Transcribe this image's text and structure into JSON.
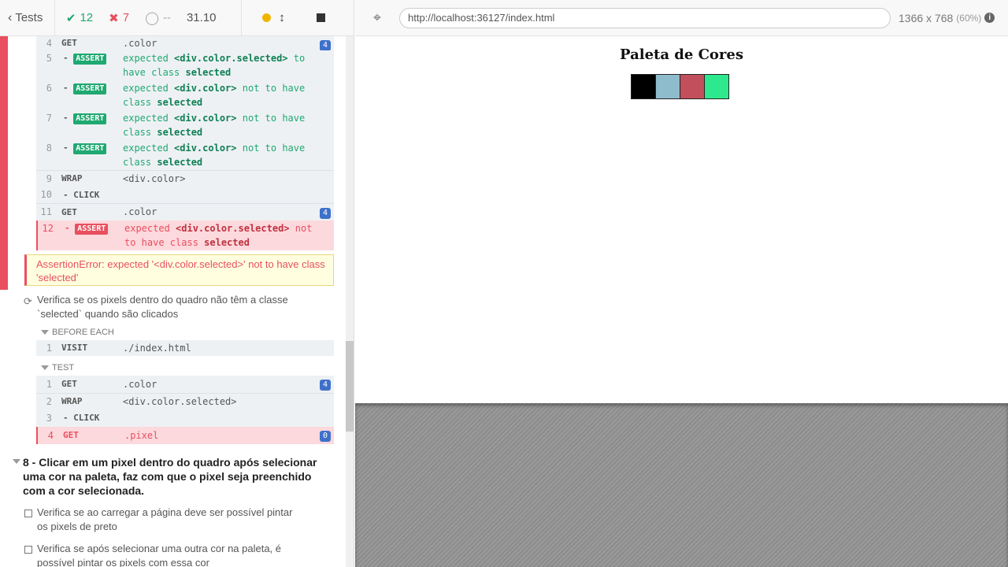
{
  "reporter_header": {
    "tests_label": "Tests",
    "passed": "12",
    "failed": "7",
    "pending": "--",
    "duration": "31.10"
  },
  "aut_header": {
    "url": "http://localhost:36127/index.html",
    "viewport": "1366 x 768",
    "scale": "(60%)"
  },
  "commands_top": [
    {
      "num": "4",
      "name": "GET",
      "msg": ".color",
      "badge": "4"
    },
    {
      "num": "5",
      "name": "-",
      "tag": "ASSERT",
      "pre": "expected",
      "el": "<div.color.selected>",
      "mid": " to have class",
      "cls": "selected"
    },
    {
      "num": "6",
      "name": "-",
      "tag": "ASSERT",
      "pre": "expected",
      "el": "<div.color>",
      "mid": " not to have class",
      "cls": "selected"
    },
    {
      "num": "7",
      "name": "-",
      "tag": "ASSERT",
      "pre": "expected",
      "el": "<div.color>",
      "mid": " not to have class",
      "cls": "selected"
    },
    {
      "num": "8",
      "name": "-",
      "tag": "ASSERT",
      "pre": "expected",
      "el": "<div.color>",
      "mid": " not to have class",
      "cls": "selected"
    },
    {
      "num": "9",
      "name": "WRAP",
      "msg": "<div.color>"
    },
    {
      "num": "10",
      "name": "- CLICK",
      "msg": ""
    },
    {
      "num": "11",
      "name": "GET",
      "msg": ".color",
      "badge": "4"
    },
    {
      "num": "12",
      "name": "-",
      "tag": "ASSERT",
      "pre": "expected",
      "el": "<div.color.selected>",
      "mid": " not to have class",
      "cls": "selected"
    }
  ],
  "error_message": "AssertionError: expected '<div.color.selected>' not to have class 'selected'",
  "test_running": {
    "title": "Verifica se os pixels dentro do quadro não têm a classe `selected` quando são clicados",
    "before_each": "BEFORE EACH",
    "test_label": "TEST",
    "before_cmd": {
      "num": "1",
      "name": "VISIT",
      "msg": "./index.html"
    },
    "cmds": [
      {
        "num": "1",
        "name": "GET",
        "msg": ".color",
        "badge": "4"
      },
      {
        "num": "2",
        "name": "WRAP",
        "msg": "<div.color.selected>"
      },
      {
        "num": "3",
        "name": "- CLICK",
        "msg": ""
      },
      {
        "num": "4",
        "name": "GET",
        "msg": ".pixel",
        "badge": "0"
      }
    ]
  },
  "suite_8": {
    "title": "8 - Clicar em um pixel dentro do quadro após selecionar uma cor na paleta, faz com que o pixel seja preenchido com a cor selecionada.",
    "tests": [
      "Verifica se ao carregar a página deve ser possível pintar os pixels de preto",
      "Verifica se após selecionar uma outra cor na paleta, é possível pintar os pixels com essa cor"
    ]
  },
  "aut_page": {
    "title": "Paleta de Cores",
    "palette_colors": [
      "#000000",
      "#8fbccc",
      "#c2505c",
      "#2ee88d"
    ]
  }
}
